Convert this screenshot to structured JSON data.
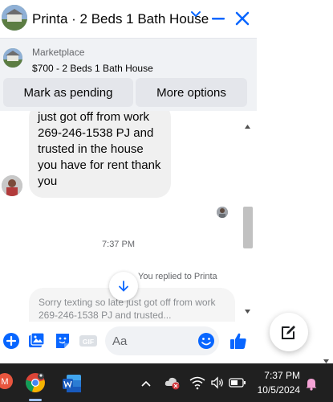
{
  "header": {
    "title": "Printa · 2 Beds 1 Bath House"
  },
  "listing": {
    "source": "Marketplace",
    "title": "$700 - 2 Beds 1 Bath House",
    "buttons": {
      "mark_pending": "Mark as pending",
      "more_options": "More options"
    }
  },
  "messages": {
    "incoming_text": "just got off from work 269-246-1538 PJ and trusted in the house you have for rent thank you",
    "timestamp": "7:37 PM",
    "replied_label": "You replied to Printa",
    "quoted_text": "Sorry texting so late just got off from work 269-246-1538 PJ and trusted..."
  },
  "composer": {
    "placeholder": "Aa",
    "gif_label": "GIF"
  },
  "taskbar": {
    "gmail_badge": "M",
    "time": "7:37 PM",
    "date": "10/5/2024"
  },
  "colors": {
    "messenger_blue": "#0866ff",
    "bubble_gray": "#f0f0f0",
    "taskbar_bg": "#202020",
    "notification_pink": "#f5a3d6"
  }
}
